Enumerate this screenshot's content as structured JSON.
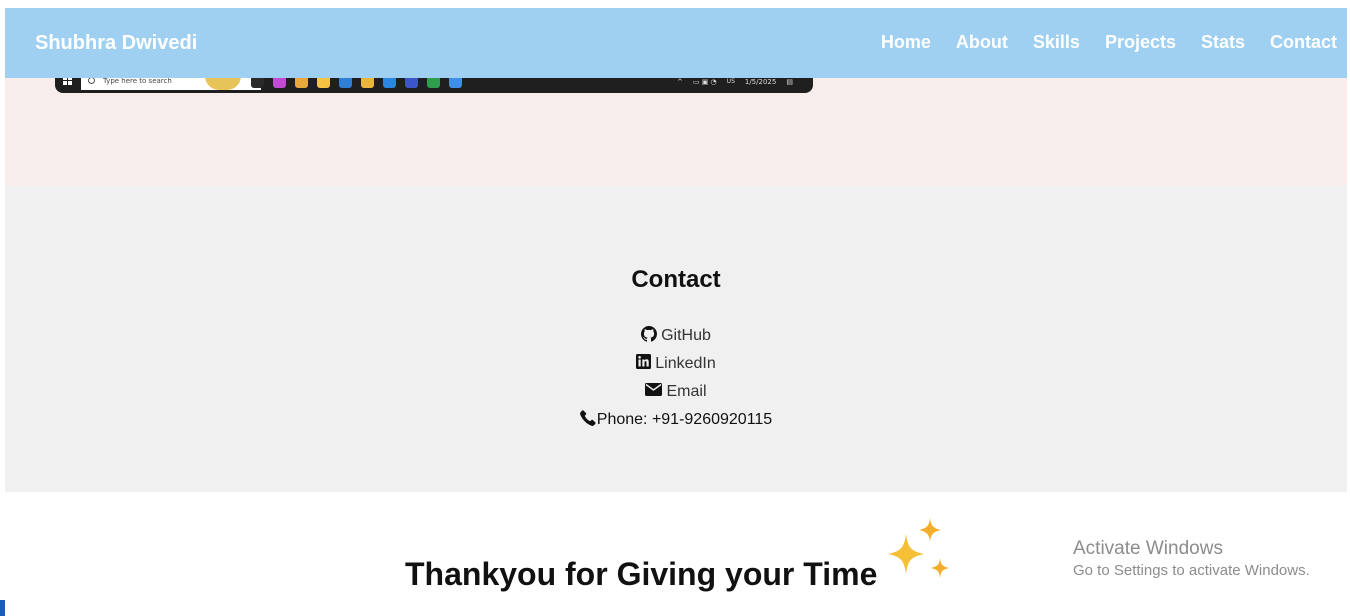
{
  "navbar": {
    "brand": "Shubhra Dwivedi",
    "links": [
      "Home",
      "About",
      "Skills",
      "Projects",
      "Stats",
      "Contact"
    ]
  },
  "screenshot_taskbar": {
    "search_placeholder": "Type here to search",
    "tray_lang": "US",
    "tray_date": "1/5/2025",
    "icon_colors": [
      "#2a2a2a",
      "#c24bd6",
      "#e8a93a",
      "#f6c342",
      "#2f7fd6",
      "#e8b63c",
      "#2a86e0",
      "#3c56c9",
      "#2e9e4e",
      "#3f8ee8"
    ]
  },
  "contact": {
    "title": "Contact",
    "items": [
      {
        "icon": "github-icon",
        "label": "GitHub"
      },
      {
        "icon": "linkedin-icon",
        "label": "LinkedIn"
      },
      {
        "icon": "envelope-icon",
        "label": "Email"
      },
      {
        "icon": "phone-icon",
        "label": "Phone: +91-9260920115"
      }
    ]
  },
  "thanks": {
    "text": "Thankyou for Giving your Time",
    "icon": "sparkles-icon"
  },
  "watermark": {
    "line1": "Activate Windows",
    "line2": "Go to Settings to activate Windows."
  },
  "colors": {
    "navbar_bg": "#9fd0f2",
    "hero_bg": "#f7eded",
    "contact_bg": "#f0f0f0",
    "sparkle": "#f5c035"
  }
}
